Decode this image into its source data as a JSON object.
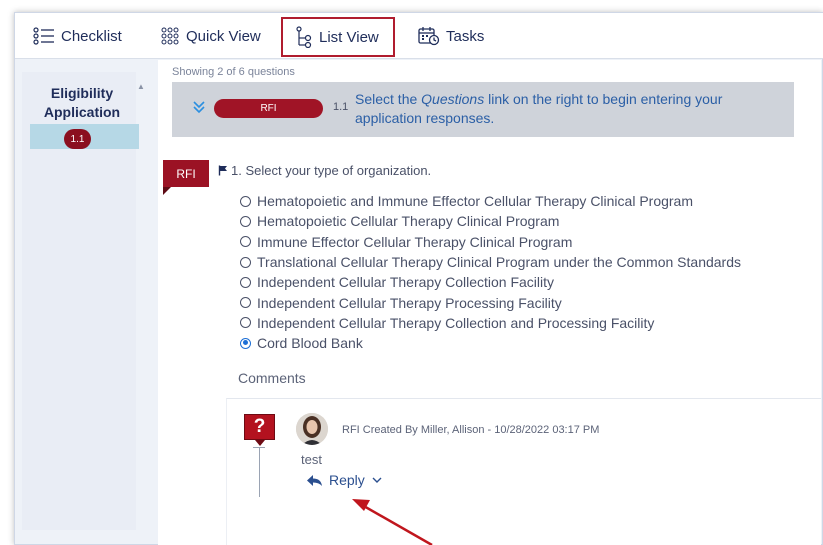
{
  "tabs": [
    {
      "label": "Checklist",
      "icon": "checklist-icon"
    },
    {
      "label": "Quick View",
      "icon": "grid-dots-icon"
    },
    {
      "label": "List View",
      "icon": "tree-icon",
      "active": true
    },
    {
      "label": "Tasks",
      "icon": "calendar-tasks-icon"
    }
  ],
  "sidebar": {
    "title": "Eligibility Application",
    "item_badge": "1.1"
  },
  "main": {
    "showing_text": "Showing 2 of 6 questions",
    "banner": {
      "pill_label": "RFI",
      "number": "1.1",
      "message_prefix": "Select the ",
      "message_link": "Questions",
      "message_suffix": " link on the right to begin entering your application responses."
    },
    "rfi_tag": "RFI",
    "question": "1. Select your type of organization.",
    "options": [
      {
        "label": "Hematopoietic and Immune Effector Cellular Therapy Clinical Program",
        "selected": false
      },
      {
        "label": "Hematopoietic Cellular Therapy Clinical Program",
        "selected": false
      },
      {
        "label": "Immune Effector Cellular Therapy Clinical Program",
        "selected": false
      },
      {
        "label": "Translational Cellular Therapy Clinical Program under the Common Standards",
        "selected": false
      },
      {
        "label": "Independent Cellular Therapy Collection Facility",
        "selected": false
      },
      {
        "label": "Independent Cellular Therapy Processing Facility",
        "selected": false
      },
      {
        "label": "Independent Cellular Therapy Collection and Processing Facility",
        "selected": false
      },
      {
        "label": "Cord Blood Bank",
        "selected": true
      }
    ],
    "comments_label": "Comments",
    "comment": {
      "qmark": "?",
      "meta": "RFI Created By Miller, Allison - 10/28/2022 03:17 PM",
      "text": "test",
      "reply_label": "Reply"
    }
  },
  "colors": {
    "accent_red": "#a01426",
    "link_blue": "#2b5fa6",
    "selected_blue": "#1d6fd6",
    "annotation_arrow": "#c0161d"
  }
}
